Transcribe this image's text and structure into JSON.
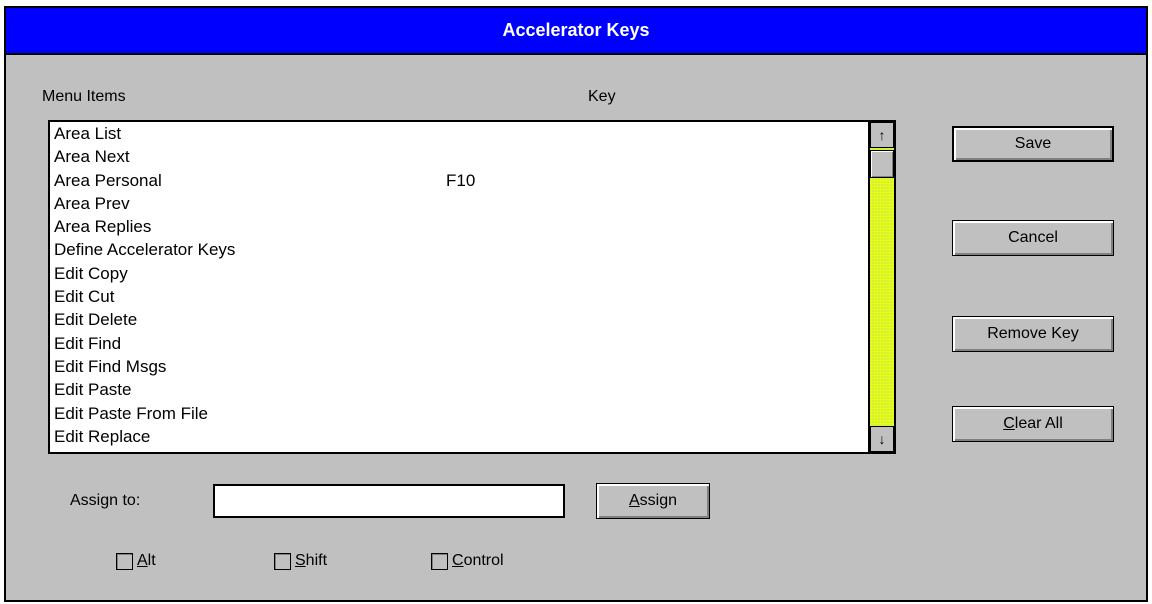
{
  "window": {
    "title": "Accelerator Keys"
  },
  "headers": {
    "menu_items": "Menu Items",
    "key": "Key"
  },
  "list": {
    "rows": [
      {
        "item": "Area List",
        "key": ""
      },
      {
        "item": "Area Next",
        "key": ""
      },
      {
        "item": "Area Personal",
        "key": "F10"
      },
      {
        "item": "Area Prev",
        "key": ""
      },
      {
        "item": "Area Replies",
        "key": ""
      },
      {
        "item": "Define Accelerator Keys",
        "key": ""
      },
      {
        "item": "Edit Copy",
        "key": ""
      },
      {
        "item": "Edit Cut",
        "key": ""
      },
      {
        "item": "Edit Delete",
        "key": ""
      },
      {
        "item": "Edit Find",
        "key": ""
      },
      {
        "item": "Edit Find Msgs",
        "key": ""
      },
      {
        "item": "Edit Paste",
        "key": ""
      },
      {
        "item": "Edit Paste From File",
        "key": ""
      },
      {
        "item": "Edit Replace",
        "key": ""
      }
    ],
    "scroll_up_glyph": "↑",
    "scroll_down_glyph": "↓"
  },
  "buttons": {
    "save": "Save",
    "cancel": "Cancel",
    "remove_key": "Remove Key",
    "clear_all_mnemonic": "C",
    "clear_all_rest": "lear All",
    "assign_mnemonic": "A",
    "assign_rest": "ssign"
  },
  "assign": {
    "label": "Assign to:",
    "value": ""
  },
  "modifiers": {
    "alt_mnemonic": "A",
    "alt_rest": "lt",
    "shift_mnemonic": "S",
    "shift_rest": "hift",
    "control_mnemonic": "C",
    "control_rest": "ontrol",
    "alt_checked": false,
    "shift_checked": false,
    "control_checked": false
  },
  "colors": {
    "title_bar": "#0000ff",
    "dialog_face": "#c0c0c0",
    "scroll_track": "#c8f040"
  }
}
